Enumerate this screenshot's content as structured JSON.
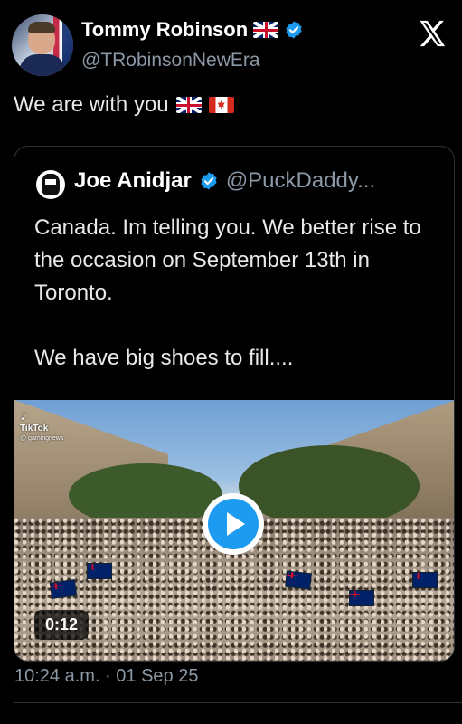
{
  "author": {
    "name": "Tommy Robinson",
    "handle": "@TRobinsonNewEra",
    "badge_emoji": "uk-flag",
    "verified_icon": "verified-badge-icon"
  },
  "tweet": {
    "text": "We are with you",
    "emojis": [
      "uk-flag",
      "canada-flag"
    ]
  },
  "platform_icon": "x-logo-icon",
  "quoted": {
    "name": "Joe Anidjar",
    "handle": "@PuckDaddy...",
    "paragraphs": [
      "Canada. Im telling you. We better rise to the occasion on September 13th in Toronto.",
      "We have big shoes to fill...."
    ],
    "video": {
      "watermark_brand": "TikTok",
      "watermark_user": "@ gamingnews",
      "duration": "0:12"
    }
  },
  "timestamp": "10:24 a.m. · 01 Sep 25",
  "colors": {
    "background": "#000000",
    "text": "#e7e9ea",
    "secondary": "#8b98a5",
    "accent": "#1d9bf0",
    "border": "#2f3336"
  }
}
